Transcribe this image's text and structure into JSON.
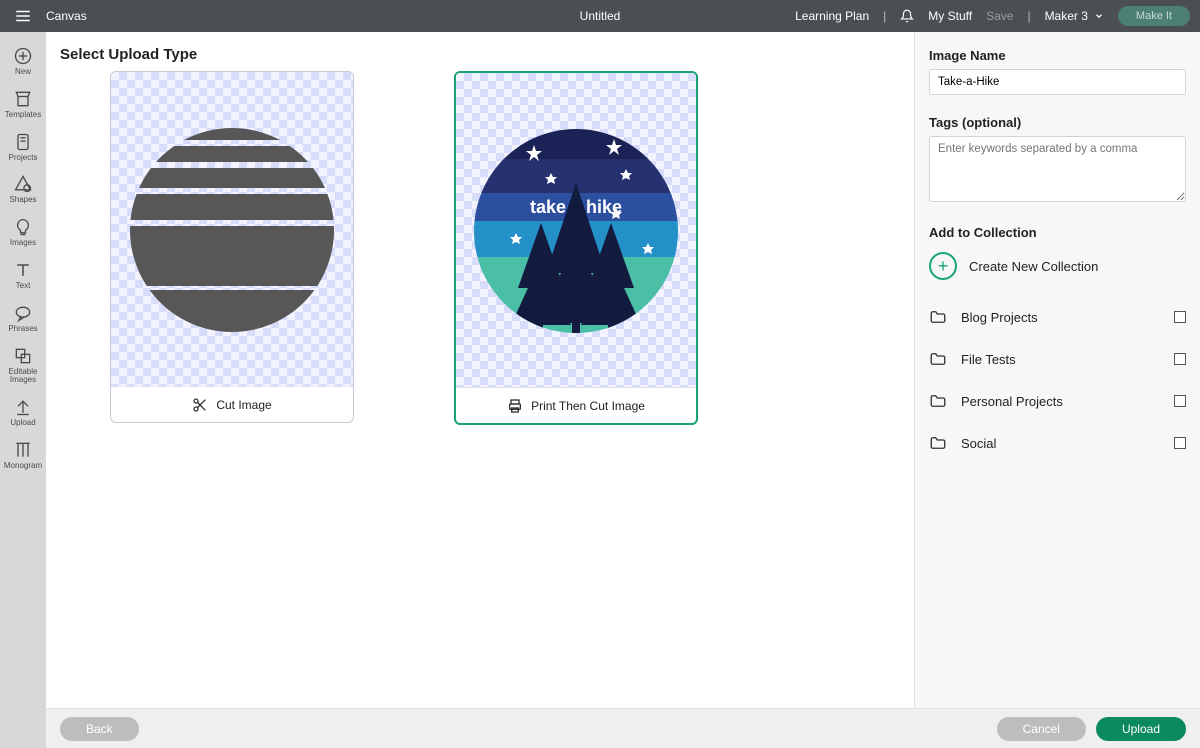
{
  "topbar": {
    "canvas": "Canvas",
    "title": "Untitled",
    "learning_plan": "Learning Plan",
    "my_stuff": "My Stuff",
    "save": "Save",
    "machine": "Maker 3",
    "make_it": "Make It"
  },
  "rail": {
    "new": "New",
    "templates": "Templates",
    "projects": "Projects",
    "shapes": "Shapes",
    "images": "Images",
    "text": "Text",
    "phrases": "Phrases",
    "editable_images": "Editable\nImages",
    "upload": "Upload",
    "monogram": "Monogram"
  },
  "main": {
    "heading": "Select Upload Type",
    "cut_label": "Cut Image",
    "ptc_label": "Print Then Cut Image",
    "ptc_art_text": "take a hike"
  },
  "panel": {
    "image_name_label": "Image Name",
    "image_name_value": "Take-a-Hike",
    "tags_label": "Tags (optional)",
    "tags_placeholder": "Enter keywords separated by a comma",
    "add_collection_label": "Add to Collection",
    "create_new": "Create New Collection",
    "collections": [
      {
        "name": "Blog Projects"
      },
      {
        "name": "File Tests"
      },
      {
        "name": "Personal Projects"
      },
      {
        "name": "Social"
      }
    ]
  },
  "footer": {
    "back": "Back",
    "cancel": "Cancel",
    "upload": "Upload"
  }
}
